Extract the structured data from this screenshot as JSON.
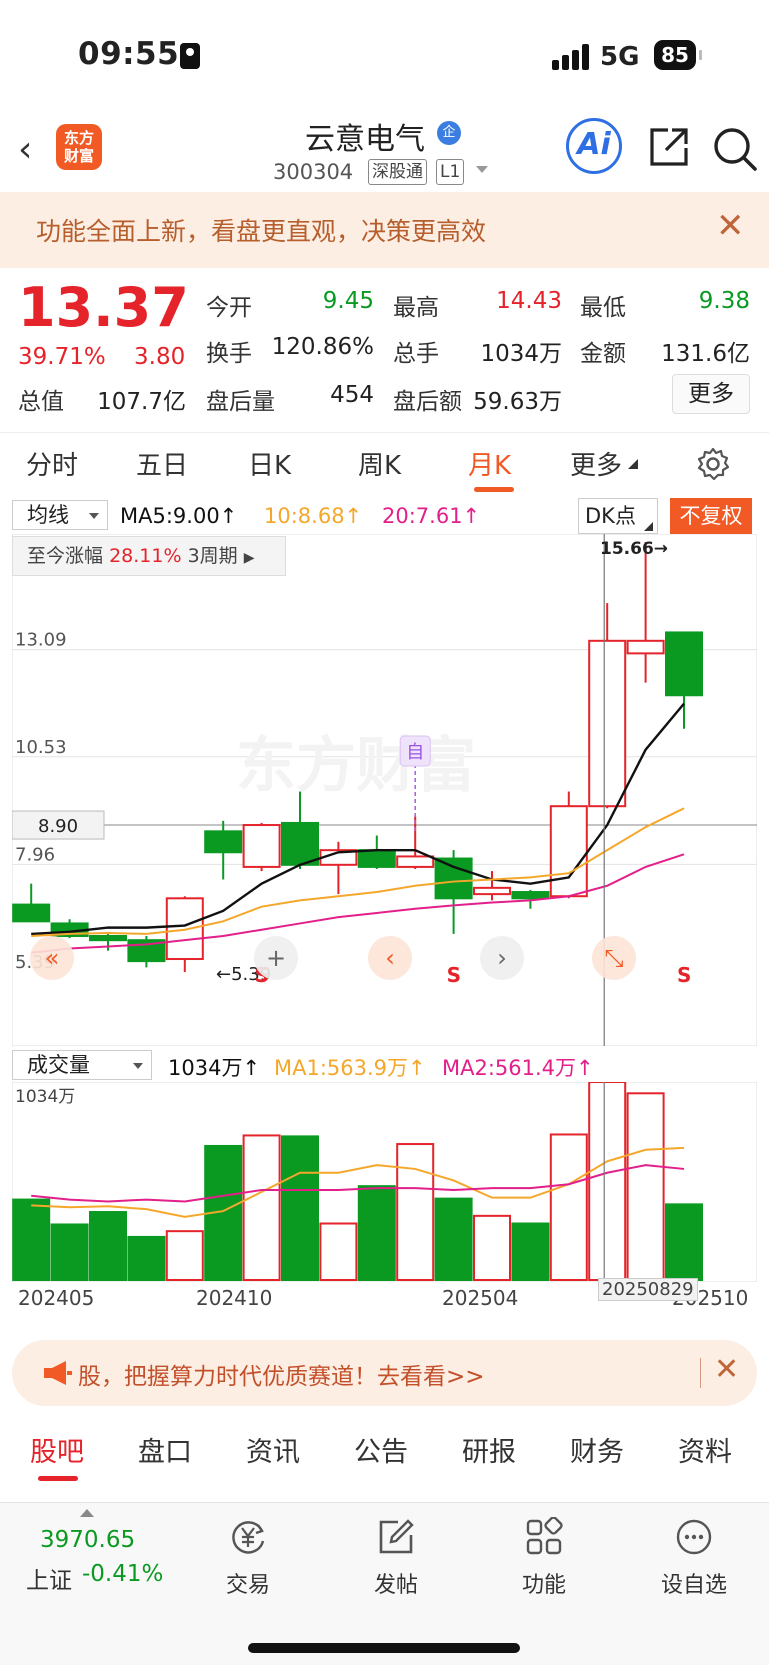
{
  "status_bar": {
    "time": "09:55",
    "network": "5G",
    "battery": "85"
  },
  "nav": {
    "logo": [
      "东方",
      "财富"
    ],
    "stock_name": "云意电气",
    "qi_badge": "企",
    "code": "300304",
    "tag1": "深股通",
    "tag2": "L1",
    "ai_label": "Ai"
  },
  "banner": {
    "text": "功能全面上新，看盘更直观，决策更高效",
    "close": "✕"
  },
  "quote": {
    "price": "13.37",
    "pct": "39.71%",
    "change": "3.80",
    "open_label": "今开",
    "open": "9.45",
    "high_label": "最高",
    "high": "14.43",
    "low_label": "最低",
    "low": "9.38",
    "turnover_label": "换手",
    "turnover": "120.86%",
    "volume_label": "总手",
    "volume": "1034万",
    "amount_label": "金额",
    "amount": "131.6亿",
    "mktcap_label": "总值",
    "mktcap": "107.7亿",
    "after_vol_label": "盘后量",
    "after_vol": "454",
    "after_amt_label": "盘后额",
    "after_amt": "59.63万",
    "more": "更多"
  },
  "tabs": [
    "分时",
    "五日",
    "日K",
    "周K",
    "月K",
    "更多"
  ],
  "chart_head": {
    "indicator": "均线",
    "ma5": "MA5:9.00↑",
    "ma10": "10:8.68↑",
    "ma20": "20:7.61↑",
    "dk": "DK点",
    "fq": "不复权",
    "range_label": "至今涨幅",
    "range_pct": "28.11%",
    "range_period": "3周期",
    "high_mark": "15.66→",
    "low_mark": "←5.39",
    "crosshair_price": "8.90",
    "self_marker": "自",
    "s_marker": "S"
  },
  "colors": {
    "up": "#e4232a",
    "down": "#0a9a22",
    "ma5": "#111111",
    "ma10": "#f4a72a",
    "ma20": "#e21f8a",
    "accent": "#f15a24"
  },
  "chart_data": {
    "type": "candlestick",
    "y_ticks": [
      "13.09",
      "10.53",
      "7.96",
      "5.39"
    ],
    "ylim": [
      5.39,
      15.66
    ],
    "candles": [
      {
        "o": 7.0,
        "h": 7.5,
        "l": 6.7,
        "c": 6.6
      },
      {
        "o": 6.55,
        "h": 6.65,
        "l": 6.2,
        "c": 6.25
      },
      {
        "o": 6.25,
        "h": 6.3,
        "l": 5.9,
        "c": 6.15
      },
      {
        "o": 6.15,
        "h": 6.25,
        "l": 5.5,
        "c": 5.65
      },
      {
        "o": 5.7,
        "h": 7.2,
        "l": 5.39,
        "c": 7.15
      },
      {
        "o": 8.75,
        "h": 9.0,
        "l": 7.6,
        "c": 8.25
      },
      {
        "o": 7.9,
        "h": 8.95,
        "l": 7.8,
        "c": 8.9
      },
      {
        "o": 8.95,
        "h": 9.7,
        "l": 7.85,
        "c": 7.95
      },
      {
        "o": 7.95,
        "h": 8.5,
        "l": 7.25,
        "c": 8.3
      },
      {
        "o": 8.3,
        "h": 8.65,
        "l": 7.85,
        "c": 7.9
      },
      {
        "o": 7.9,
        "h": 9.1,
        "l": 7.85,
        "c": 8.15
      },
      {
        "o": 8.1,
        "h": 8.3,
        "l": 6.3,
        "c": 7.15
      },
      {
        "o": 7.25,
        "h": 7.8,
        "l": 7.1,
        "c": 7.4
      },
      {
        "o": 7.3,
        "h": 7.35,
        "l": 6.9,
        "c": 7.15
      },
      {
        "o": 7.2,
        "h": 9.7,
        "l": 7.15,
        "c": 9.35
      },
      {
        "o": 9.35,
        "h": 14.2,
        "l": 9.3,
        "c": 13.3
      },
      {
        "o": 13.0,
        "h": 15.66,
        "l": 12.3,
        "c": 13.3
      },
      {
        "o": 13.5,
        "h": 13.5,
        "l": 11.2,
        "c": 12.0
      }
    ],
    "ma5": [
      6.3,
      6.35,
      6.45,
      6.45,
      6.5,
      6.85,
      7.5,
      7.95,
      8.25,
      8.3,
      8.3,
      7.9,
      7.6,
      7.5,
      7.65,
      8.9,
      10.7,
      11.8
    ],
    "ma10": [
      6.25,
      6.3,
      6.32,
      6.3,
      6.4,
      6.6,
      6.95,
      7.1,
      7.2,
      7.3,
      7.45,
      7.55,
      7.6,
      7.65,
      7.75,
      8.3,
      8.85,
      9.3
    ],
    "ma20": [
      5.85,
      5.95,
      6.0,
      6.05,
      6.15,
      6.25,
      6.4,
      6.55,
      6.7,
      6.8,
      6.9,
      6.98,
      7.05,
      7.1,
      7.2,
      7.45,
      7.9,
      8.2
    ],
    "volume_label": "成交量",
    "volume_current": "1034万↑",
    "vol_ma1": "MA1:563.9万↑",
    "vol_ma2": "MA2:561.4万↑",
    "vol_top_label": "1034万",
    "volumes": [
      420,
      290,
      355,
      225,
      255,
      700,
      755,
      750,
      295,
      490,
      710,
      425,
      335,
      295,
      760,
      1034,
      975,
      395
    ],
    "vol_ma1_line": [
      390,
      380,
      385,
      370,
      330,
      360,
      460,
      560,
      560,
      600,
      580,
      520,
      430,
      430,
      500,
      620,
      680,
      690
    ],
    "vol_ma2_line": [
      440,
      420,
      410,
      420,
      410,
      440,
      470,
      470,
      470,
      480,
      480,
      470,
      480,
      480,
      500,
      560,
      600,
      580
    ],
    "x_labels": [
      "202405",
      "202410",
      "202504",
      "202510"
    ],
    "crosshair_date": "20250829"
  },
  "chart_nav": {
    "prev": "‹",
    "next": "›",
    "zoom": "+"
  },
  "ad": {
    "text": "股，把握算力时代优质赛道！去看看>>",
    "close": "✕"
  },
  "sub_tabs": [
    "股吧",
    "盘口",
    "资讯",
    "公告",
    "研报",
    "财务",
    "资料"
  ],
  "bottom_bar": {
    "index_value": "3970.65",
    "index_name": "上证",
    "index_pct": "-0.41%",
    "items": [
      "交易",
      "发帖",
      "功能",
      "设自选"
    ]
  }
}
